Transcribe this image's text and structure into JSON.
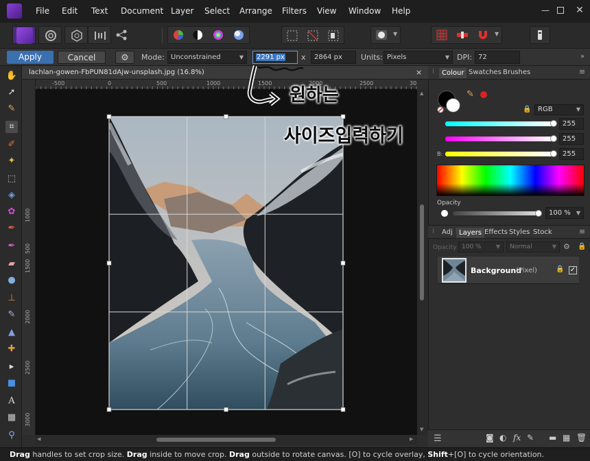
{
  "menubar": {
    "items": [
      "File",
      "Edit",
      "Text",
      "Document",
      "Layer",
      "Select",
      "Arrange",
      "Filters",
      "View",
      "Window",
      "Help"
    ]
  },
  "context": {
    "apply": "Apply",
    "cancel": "Cancel",
    "mode_label": "Mode:",
    "mode_value": "Unconstrained",
    "width_value": "2291 px",
    "x_sep": "x",
    "height_value": "2864 px",
    "units_label": "Units:",
    "units_value": "Pixels",
    "dpi_label": "DPI:",
    "dpi_value": "72"
  },
  "document": {
    "tab_title": "lachlan-gowen-FbPUN81dAjw-unsplash.jpg (16.8%)",
    "close": "×",
    "ruler_unit": "px",
    "ruler_top": [
      "-500",
      "0",
      "500",
      "1000",
      "1500",
      "2000",
      "2500",
      "30"
    ],
    "ruler_left": [
      "500",
      "1000",
      "1500",
      "2000",
      "2500",
      "3000"
    ]
  },
  "annotation": {
    "line1": "원하는",
    "line2": "사이즈입력하기"
  },
  "colour_panel": {
    "tabs": [
      "Colour",
      "Swatches",
      "Brushes"
    ],
    "model": "RGB",
    "r": "255",
    "g": "255",
    "b": "255",
    "b_label": "B:",
    "opacity_label": "Opacity",
    "opacity_value": "100 %"
  },
  "layers_panel": {
    "tabs": [
      "Adj",
      "Layers",
      "Effects",
      "Styles",
      "Stock"
    ],
    "opacity_label": "Opacity",
    "opacity_value": "100 %",
    "blend_mode": "Normal",
    "layer_name": "Background",
    "layer_type": "(Pixel)"
  },
  "status": {
    "parts": [
      {
        "b": "Drag",
        "t": " handles to set crop size. "
      },
      {
        "b": "Drag",
        "t": " inside to move crop. "
      },
      {
        "b": "Drag",
        "t": " outside to rotate canvas. [O] to cycle overlay, "
      },
      {
        "b": "Shift",
        "t": "+[O] to cycle orientation."
      }
    ]
  },
  "colors": {
    "accent": "#4a90d9",
    "apply_bg": "#3a6fb0",
    "selected_field": "#3b78c4",
    "record_red": "#e02020"
  }
}
